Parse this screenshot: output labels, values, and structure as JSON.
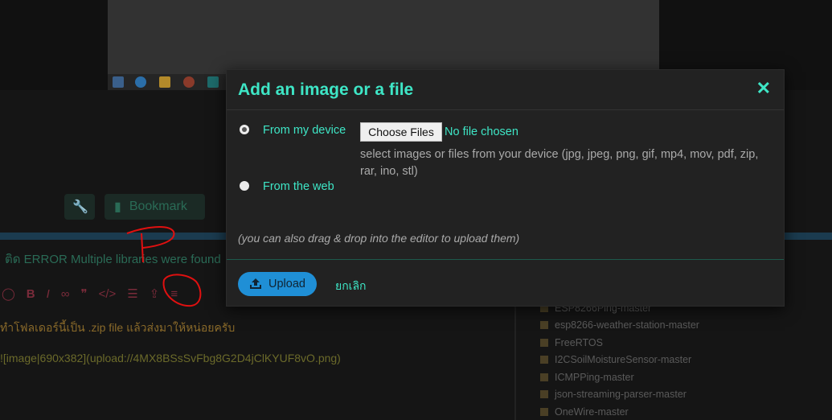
{
  "background": {
    "bookmark_label": "Bookmark",
    "topic_line": "ติด ERROR Multiple libraries were found",
    "post_line1": "ทำโฟลเดอร์นี้เป็น .zip file แล้วส่งมาให้หน่อยครับ",
    "post_line2": "![image|690x382](upload://4MX8BSsSvFbg8G2D4jClKYUF8vO.png)",
    "file_list": [
      "ESP8266Ping-master",
      "esp8266-weather-station-master",
      "FreeRTOS",
      "I2CSoilMoistureSensor-master",
      "ICMPPing-master",
      "json-streaming-parser-master",
      "OneWire-master"
    ]
  },
  "modal": {
    "title": "Add an image or a file",
    "close_icon": "close-icon",
    "options": [
      {
        "label": "From my device",
        "checked": true
      },
      {
        "label": "From the web",
        "checked": false
      }
    ],
    "choose_files_label": "Choose Files",
    "no_file_text": "No file chosen",
    "hint": "select images or files from your device (jpg, jpeg, png, gif, mp4, mov, pdf, zip, rar, ino, stl)",
    "drag_drop_note": "(you can also drag & drop into the editor to upload them)",
    "upload_label": "Upload",
    "cancel_label": "ยกเลิก"
  },
  "colors": {
    "accent": "#3ee6c6",
    "upload_button": "#1f8fd6",
    "annotation_red": "#e01010"
  }
}
